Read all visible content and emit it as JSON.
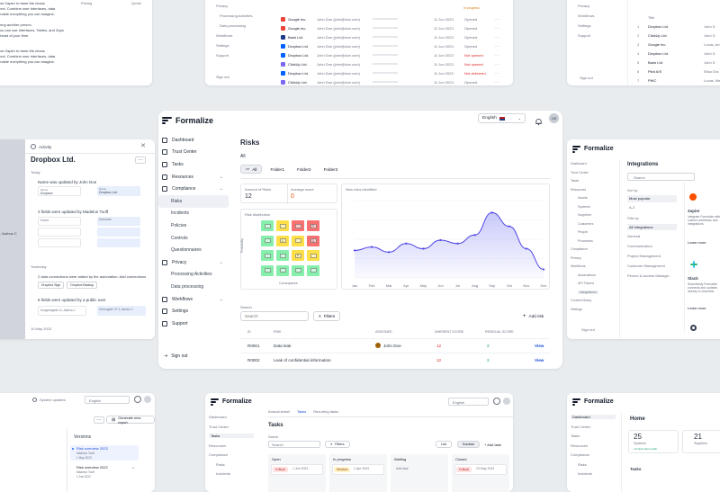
{
  "brand": {
    "name": "Formalize"
  },
  "main": {
    "lang": "English",
    "avatar": "LW",
    "nav": [
      {
        "label": "Dashboard",
        "icon": "dashboard-icon"
      },
      {
        "label": "Trust Center",
        "icon": "trust-center-icon"
      },
      {
        "label": "Tasks",
        "icon": "tasks-icon"
      },
      {
        "label": "Resources",
        "icon": "resources-icon",
        "chev": true
      },
      {
        "label": "Compliance",
        "icon": "compliance-icon",
        "chev": true
      },
      {
        "label": "Risks",
        "sub": true,
        "active": true
      },
      {
        "label": "Incidents",
        "sub": true
      },
      {
        "label": "Policies",
        "sub": true
      },
      {
        "label": "Controls",
        "sub": true
      },
      {
        "label": "Questionnaires",
        "sub": true
      },
      {
        "label": "Privacy",
        "icon": "privacy-icon",
        "chev": true
      },
      {
        "label": "Processing Activities",
        "sub": true
      },
      {
        "label": "Data processing",
        "sub": true
      },
      {
        "label": "Workflows",
        "icon": "workflows-icon",
        "chev": true
      },
      {
        "label": "Settings",
        "icon": "settings-icon"
      },
      {
        "label": "Support",
        "icon": "support-icon"
      }
    ],
    "signout": "Sign out",
    "title": "Risks",
    "section": "All",
    "folders": [
      "All",
      "Folder1",
      "Folder2",
      "Folder3"
    ],
    "stats": {
      "amount_label": "Amount of Risks",
      "amount": "12",
      "avg_label": "Average score",
      "avg": "0"
    },
    "dist_title": "Risk distribution",
    "dist_ylabel": "Probability",
    "dist_xlabel": "Consequence",
    "matrix": [
      [
        "",
        "",
        "",
        "1"
      ],
      [
        "",
        "1",
        "",
        "1"
      ],
      [
        "",
        "",
        "2",
        ""
      ],
      [
        "",
        "",
        "",
        ""
      ]
    ],
    "new_title": "New risks identified",
    "search_label": "Search",
    "search_placeholder": "Search",
    "filters": "Filters",
    "add_risk": "Add risk",
    "columns": [
      "ID",
      "RISK",
      "ASSIGNED",
      "INHERENT SCORE",
      "RESIDUAL SCORE"
    ],
    "rows": [
      {
        "id": "R0001",
        "risk": "Data leak",
        "assigned": "John Doe",
        "inherent": "12",
        "residual": "2",
        "action": "View"
      },
      {
        "id": "R0002",
        "risk": "Leak of confidential information",
        "assigned": "",
        "inherent": "12",
        "residual": "2",
        "action": "View"
      }
    ]
  },
  "chart_data": {
    "type": "area",
    "title": "New risks identified",
    "x": [
      "Jan",
      "Feb",
      "Mar",
      "Apr",
      "May",
      "Jun",
      "Jul",
      "Aug",
      "Sep",
      "Oct",
      "Nov",
      "Dec"
    ],
    "values": [
      16,
      18,
      15,
      20,
      17,
      22,
      20,
      25,
      38,
      30,
      17,
      5
    ],
    "ylim": [
      0,
      45
    ],
    "grid": true
  },
  "activity": {
    "title": "Activity",
    "company": "Dropbox Ltd.",
    "today": "Today",
    "yesterday": "Yesterday",
    "entries": [
      "Name was updated by John Doe",
      "2 fields were updated by Madelon Tooff",
      "2 data connections were added by the automation: Add connections",
      "6 fields were updated by a public user"
    ],
    "names": [
      "Dropbox",
      "Dropbox Ltd."
    ],
    "countries": [
      "Korea",
      "Denmark"
    ],
    "connections": [
      "Dropbox Sign",
      "Dropbox Backup"
    ],
    "addr": [
      "Kongensgade 11, Aarhus C",
      "Greengade 37 3, Aarhus C"
    ],
    "date": "10 May 2023"
  },
  "integrations": {
    "title": "Integrations",
    "search": "Search",
    "sort_by": "Sort by",
    "sort_opts": [
      "Most popular",
      "A-Z"
    ],
    "filter_by": "Filter by",
    "filters": [
      "All Integrations",
      "General",
      "Communication",
      "Project Management",
      "Customer Management",
      "Person & Access Manage..."
    ],
    "apps": [
      {
        "name": "Zapier",
        "desc": "Integrate Formalize with custom workflows and integrations.",
        "more": "Learn more"
      },
      {
        "name": "Slack",
        "desc": "Seamlessly Formalize connects and updates directly to channels.",
        "more": "Learn more"
      }
    ],
    "nav": [
      "Dashboard",
      "Trust Center",
      "Tasks",
      "Resources",
      "Assets",
      "Systems",
      "Suppliers",
      "Customers",
      "People",
      "Processes",
      "Compliance",
      "Privacy",
      "Workflows",
      "Automations",
      "API Tokens",
      "Integrations",
      "Context library",
      "Settings"
    ],
    "signout": "Sign out",
    "brand": "Formalize"
  },
  "tasks": {
    "brand": "Formalize",
    "tabs": [
      "Annual wheel",
      "Tasks",
      "Recurring tasks"
    ],
    "title": "Tasks",
    "search": "Search",
    "filters": "Filters",
    "views": [
      "List",
      "Kanban"
    ],
    "add_task": "Add task",
    "columns": [
      "Open",
      "In progress",
      "Waiting",
      "Closed"
    ],
    "cards": [
      {
        "tag": "Critical",
        "date": "1 Jun 2023"
      },
      {
        "tag": "Medium",
        "date": "1 Apr 2023"
      },
      {
        "tag": "Critical",
        "date": "10 May 2023"
      }
    ],
    "add": "Add task",
    "nav": [
      "Dashboard",
      "Trust Center",
      "Tasks",
      "Resources",
      "Compliance",
      "Risks",
      "Incidents"
    ],
    "lang": "English"
  },
  "home": {
    "brand": "Formalize",
    "title": "Home",
    "stats": [
      {
        "value": "25",
        "label": "Systems",
        "delta": "+5 since last month"
      },
      {
        "value": "21",
        "label": "Suppliers"
      }
    ],
    "tasks": "Tasks",
    "nav": [
      "Dashboard",
      "Trust Center",
      "Tasks",
      "Resources",
      "Compliance",
      "Risks",
      "Incidents"
    ]
  },
  "versions": {
    "updates": "System updates",
    "lang": "English",
    "generate": "Generate new report",
    "title": "Versions",
    "items": [
      {
        "name": "Risk overview 2023",
        "by": "Madelon Tooff",
        "date": "1 May 2023"
      },
      {
        "name": "Risk overview 2022",
        "by": "Madelon Tooff",
        "date": "1 Jan 2022"
      }
    ]
  },
  "suppliers_table": {
    "rows": [
      {
        "name": "Google Inc.",
        "owner": "John Doe (john@doe.com)",
        "date": "11 Jun 2023",
        "status": "Opened"
      },
      {
        "name": "Google Inc.",
        "owner": "John Doe (john@doe.com)",
        "date": "11 Jun 2023",
        "status": "Opened"
      },
      {
        "name": "Bank Ltd.",
        "owner": "John Doe (john@doe.com)",
        "date": "11 Jun 2023",
        "status": "Opened"
      },
      {
        "name": "Dropbox Ltd.",
        "owner": "John Doe (john@doe.com)",
        "date": "11 Jun 2023",
        "status": "Opened"
      },
      {
        "name": "Dropbox Ltd.",
        "owner": "John Doe (john@doe.com)",
        "date": "11 Jun 2023",
        "status": "Not opened"
      },
      {
        "name": "ClickUp Ltd.",
        "owner": "John Doe (john@doe.com)",
        "date": "11 Jun 2023",
        "status": "Not opened"
      },
      {
        "name": "Dropbox Ltd.",
        "owner": "John Doe (john@doe.com)",
        "date": "11 Jun 2023",
        "status": "Not delivered"
      },
      {
        "name": "ClickUp Ltd.",
        "owner": "John Doe (john@doe.com)",
        "date": "11 Jun 2023",
        "status": "Opened"
      }
    ],
    "top_status": "In progress",
    "nav": [
      "Privacy",
      "Processing Activities",
      "Data processing",
      "Workflows",
      "Settings",
      "Support"
    ],
    "signout": "Sign out"
  },
  "right_top": {
    "nav": [
      "Privacy",
      "Workflows",
      "Settings",
      "Support"
    ],
    "signout": "Sign out",
    "col": "Title",
    "rows": [
      "Dropbox Ltd.",
      "ClickUp Ltd.",
      "Google Inc.",
      "Dropbox Ltd.",
      "Bank Ltd.",
      "Pilot A/S",
      "PWC"
    ],
    "right": [
      "John D",
      "John D",
      "Lucas, Am",
      "John D",
      "John D",
      "Elisa Gra",
      "Lucas, Ma"
    ]
  },
  "left_top": {
    "lines": [
      "use Zapier to tame the chaos",
      "next. Combine user interfaces, data",
      "enable everything you can imagine.",
      "thing another person.",
      "you can use Interfaces, Tables, and Zaps",
      "ahead of your time.",
      "use Zapier to tame the chaos",
      "next. Combine user interfaces, data",
      "enable everything you can imagine."
    ],
    "cols": [
      "Pricing",
      "Quote"
    ]
  }
}
